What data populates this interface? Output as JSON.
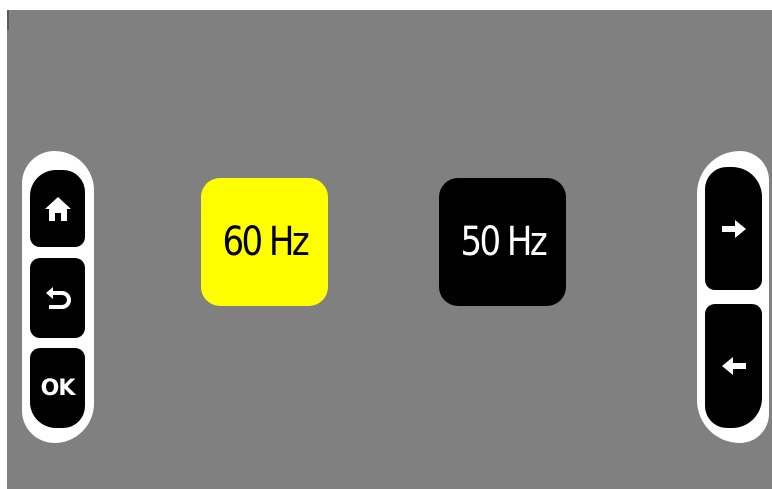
{
  "options": [
    {
      "label": "60 Hz",
      "selected": true
    },
    {
      "label": "50 Hz",
      "selected": false
    }
  ],
  "nav_left": {
    "home_icon": "home-icon",
    "back_icon": "return-icon",
    "ok_label": "OK"
  },
  "nav_right": {
    "next_icon": "arrow-right-icon",
    "prev_icon": "arrow-left-icon"
  },
  "colors": {
    "background": "#808080",
    "selected_bg": "#ffff00",
    "selected_text": "#000000",
    "unselected_bg": "#000000",
    "unselected_text": "#ffffff",
    "panel": "#ffffff"
  }
}
